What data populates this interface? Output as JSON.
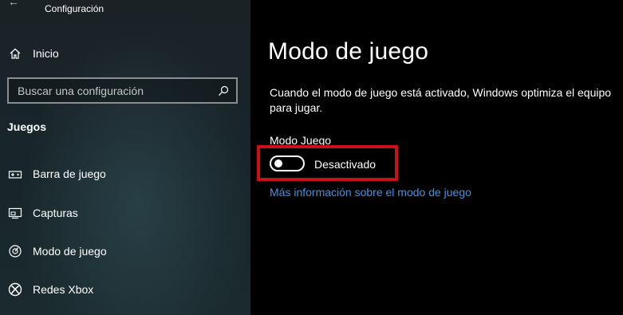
{
  "window": {
    "title": "Configuración",
    "back_icon": "back-arrow-icon"
  },
  "sidebar": {
    "home": {
      "label": "Inicio",
      "icon": "home-icon"
    },
    "search": {
      "placeholder": "Buscar una configuración",
      "value": "",
      "icon": "search-icon"
    },
    "section_title": "Juegos",
    "items": [
      {
        "label": "Barra de juego",
        "icon": "game-bar-icon"
      },
      {
        "label": "Capturas",
        "icon": "captures-icon"
      },
      {
        "label": "Modo de juego",
        "icon": "game-mode-icon"
      },
      {
        "label": "Redes Xbox",
        "icon": "xbox-icon"
      }
    ]
  },
  "main": {
    "title": "Modo de juego",
    "description": "Cuando el modo de juego está activado, Windows optimiza el equipo para jugar.",
    "setting_label": "Modo Juego",
    "toggle_state": "Desactivado",
    "toggle_on": false,
    "more_info_link": "Más información sobre el modo de juego"
  },
  "colors": {
    "highlight": "#c8101b",
    "link": "#3f94e6",
    "main_background": "#000000"
  }
}
